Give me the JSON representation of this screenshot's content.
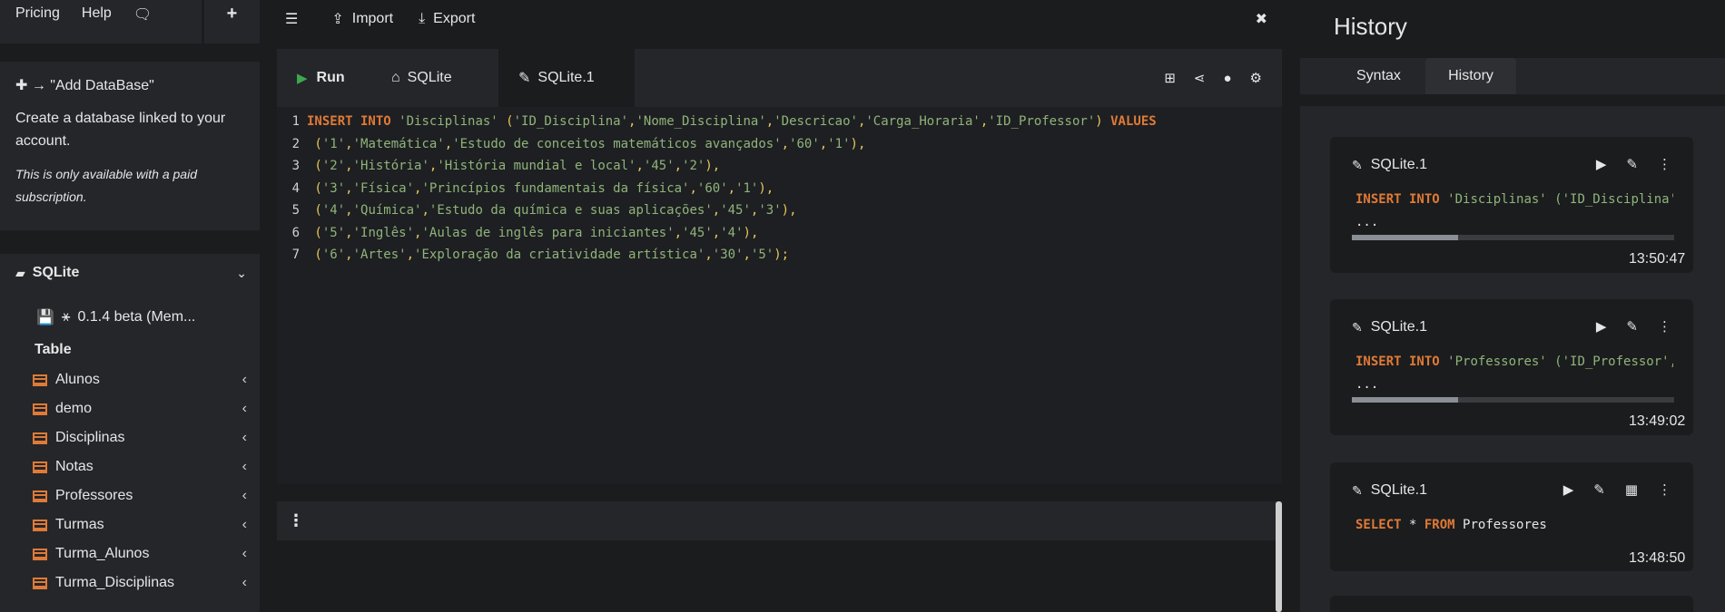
{
  "topnav": {
    "pricing": "Pricing",
    "help": "Help",
    "chat_icon": "chat-icon",
    "plus": "+"
  },
  "promo": {
    "add_label": "→ \"Add DataBase\"",
    "desc": "Create a database linked to your account.",
    "note": "This is only available with a paid subscription."
  },
  "database": {
    "name": "SQLite",
    "version": "0.1.4 beta (Mem...",
    "table_heading": "Table",
    "tables": [
      "Alunos",
      "demo",
      "Disciplinas",
      "Notas",
      "Professores",
      "Turmas",
      "Turma_Alunos",
      "Turma_Disciplinas"
    ]
  },
  "toolbar": {
    "import": "Import",
    "export": "Export",
    "close": "✖"
  },
  "editor": {
    "run": "Run",
    "tab_db": "SQLite",
    "tab_file": "SQLite.1",
    "lines": [
      [
        [
          "kw",
          "INSERT INTO "
        ],
        [
          "str",
          "'Disciplinas' "
        ],
        [
          "pun",
          "("
        ],
        [
          "str",
          "'ID_Disciplina'"
        ],
        [
          "pun",
          ","
        ],
        [
          "str",
          "'Nome_Disciplina'"
        ],
        [
          "pun",
          ","
        ],
        [
          "str",
          "'Descricao'"
        ],
        [
          "pun",
          ","
        ],
        [
          "str",
          "'Carga_Horaria'"
        ],
        [
          "pun",
          ","
        ],
        [
          "str",
          "'ID_Professor'"
        ],
        [
          "pun",
          ") "
        ],
        [
          "kw",
          "VALUES"
        ]
      ],
      [
        [
          "pun",
          " ("
        ],
        [
          "str",
          "'1'"
        ],
        [
          "pun",
          ","
        ],
        [
          "str",
          "'Matemática'"
        ],
        [
          "pun",
          ","
        ],
        [
          "str",
          "'Estudo de conceitos matemáticos avançados'"
        ],
        [
          "pun",
          ","
        ],
        [
          "str",
          "'60'"
        ],
        [
          "pun",
          ","
        ],
        [
          "str",
          "'1'"
        ],
        [
          "pun",
          "),"
        ]
      ],
      [
        [
          "pun",
          " ("
        ],
        [
          "str",
          "'2'"
        ],
        [
          "pun",
          ","
        ],
        [
          "str",
          "'História'"
        ],
        [
          "pun",
          ","
        ],
        [
          "str",
          "'História mundial e local'"
        ],
        [
          "pun",
          ","
        ],
        [
          "str",
          "'45'"
        ],
        [
          "pun",
          ","
        ],
        [
          "str",
          "'2'"
        ],
        [
          "pun",
          "),"
        ]
      ],
      [
        [
          "pun",
          " ("
        ],
        [
          "str",
          "'3'"
        ],
        [
          "pun",
          ","
        ],
        [
          "str",
          "'Física'"
        ],
        [
          "pun",
          ","
        ],
        [
          "str",
          "'Princípios fundamentais da física'"
        ],
        [
          "pun",
          ","
        ],
        [
          "str",
          "'60'"
        ],
        [
          "pun",
          ","
        ],
        [
          "str",
          "'1'"
        ],
        [
          "pun",
          "),"
        ]
      ],
      [
        [
          "pun",
          " ("
        ],
        [
          "str",
          "'4'"
        ],
        [
          "pun",
          ","
        ],
        [
          "str",
          "'Química'"
        ],
        [
          "pun",
          ","
        ],
        [
          "str",
          "'Estudo da química e suas aplicações'"
        ],
        [
          "pun",
          ","
        ],
        [
          "str",
          "'45'"
        ],
        [
          "pun",
          ","
        ],
        [
          "str",
          "'3'"
        ],
        [
          "pun",
          "),"
        ]
      ],
      [
        [
          "pun",
          " ("
        ],
        [
          "str",
          "'5'"
        ],
        [
          "pun",
          ","
        ],
        [
          "str",
          "'Inglês'"
        ],
        [
          "pun",
          ","
        ],
        [
          "str",
          "'Aulas de inglês para iniciantes'"
        ],
        [
          "pun",
          ","
        ],
        [
          "str",
          "'45'"
        ],
        [
          "pun",
          ","
        ],
        [
          "str",
          "'4'"
        ],
        [
          "pun",
          "),"
        ]
      ],
      [
        [
          "pun",
          " ("
        ],
        [
          "str",
          "'6'"
        ],
        [
          "pun",
          ","
        ],
        [
          "str",
          "'Artes'"
        ],
        [
          "pun",
          ","
        ],
        [
          "str",
          "'Exploração da criatividade artística'"
        ],
        [
          "pun",
          ","
        ],
        [
          "str",
          "'30'"
        ],
        [
          "pun",
          ","
        ],
        [
          "str",
          "'5'"
        ],
        [
          "pun",
          ");"
        ]
      ]
    ]
  },
  "results": {
    "menu": "⋮"
  },
  "history": {
    "title": "History",
    "tab_syntax": "Syntax",
    "tab_history": "History",
    "entries": [
      {
        "name": "SQLite.1",
        "kw": "INSERT INTO ",
        "rest": "'Disciplinas' ('ID_Disciplina','Nome_Disciplina'",
        "ellipsis": "...",
        "progress": 0.33,
        "time": "13:50:47"
      },
      {
        "name": "SQLite.1",
        "kw": "INSERT INTO ",
        "rest": "'Professores' ('ID_Professor','Nome'",
        "ellipsis": "...",
        "progress": 0.33,
        "time": "13:49:02"
      },
      {
        "name": "SQLite.1",
        "kw": "SELECT ",
        "rest": "* ",
        "kw2": "FROM ",
        "rest2": "Professores",
        "time": "13:48:50"
      }
    ]
  },
  "colors": {
    "keyword": "#e07a36",
    "string": "#8fb47a",
    "punct": "#e6c85a",
    "run": "#3ea84e"
  }
}
